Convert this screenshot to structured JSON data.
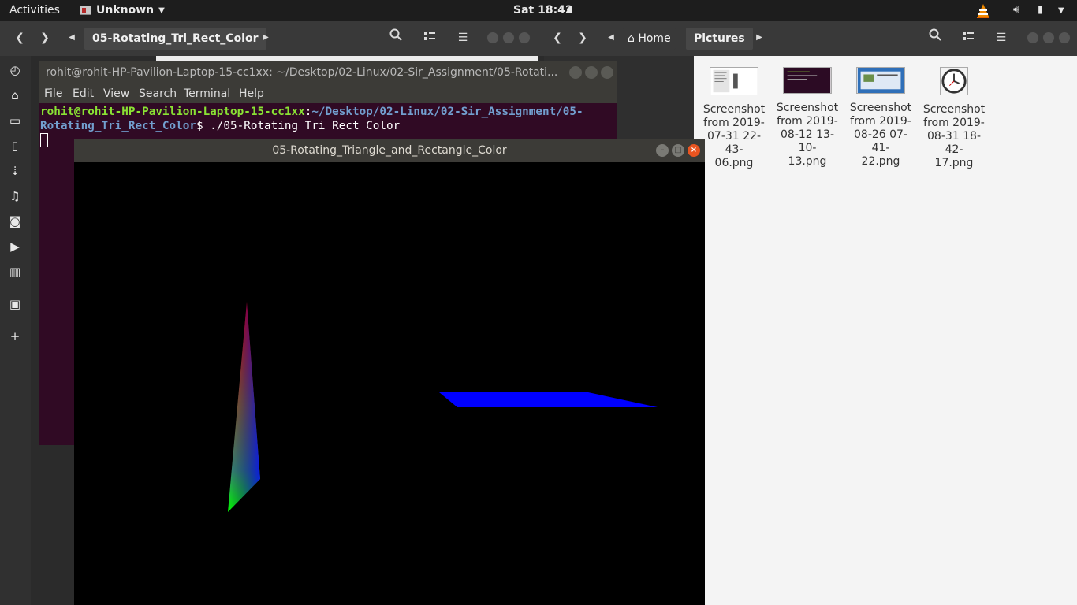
{
  "topbar": {
    "activities": "Activities",
    "app_name": "Unknown",
    "clock": "Sat 18:42"
  },
  "files_left": {
    "path_label": "05-Rotating_Tri_Rect_Color"
  },
  "files_right": {
    "home_label": "Home",
    "pictures_label": "Pictures",
    "files": [
      {
        "name": "Screenshot from 2019-07-31 22-43-06.png",
        "line1": "Screenshot",
        "line2": "from 2019-",
        "line3": "07-31 22-43-",
        "line4": "06.png"
      },
      {
        "name": "Screenshot from 2019-08-12 13-10-13.png",
        "line1": "Screenshot",
        "line2": "from 2019-",
        "line3": "08-12 13-10-",
        "line4": "13.png"
      },
      {
        "name": "Screenshot from 2019-08-26 07-41-22.png",
        "line1": "Screenshot",
        "line2": "from 2019-",
        "line3": "08-26 07-41-",
        "line4": "22.png"
      },
      {
        "name": "Screenshot from 2019-08-31 18-42-17.png",
        "line1": "Screenshot",
        "line2": "from 2019-",
        "line3": "08-31 18-42-",
        "line4": "17.png"
      }
    ]
  },
  "terminal": {
    "title": "rohit@rohit-HP-Pavilion-Laptop-15-cc1xx: ~/Desktop/02-Linux/02-Sir_Assignment/05-Rotati...",
    "menu": [
      "File",
      "Edit",
      "View",
      "Search",
      "Terminal",
      "Help"
    ],
    "prompt_user": "rohit@rohit-HP-Pavilion-Laptop-15-cc1xx",
    "prompt_path_1": "~/Desktop/02-Linux/02-Sir_Assignment/05-",
    "prompt_path_2": "Rotating_Tri_Rect_Color",
    "command": "$ ./05-Rotating_Tri_Rect_Color",
    "colon": ":"
  },
  "glwindow": {
    "title": "05-Rotating_Triangle_and_Rectangle_Color",
    "rectangle_color": "#0000ff",
    "triangle_colors": [
      "#ff0000",
      "#00ff00",
      "#0000ff"
    ]
  },
  "dock": {
    "icons": [
      "clock-icon",
      "home-icon",
      "folder-icon",
      "document-icon",
      "download-icon",
      "music-icon",
      "camera-icon",
      "video-icon",
      "trash-icon",
      "drive-icon",
      "plus-icon"
    ]
  }
}
